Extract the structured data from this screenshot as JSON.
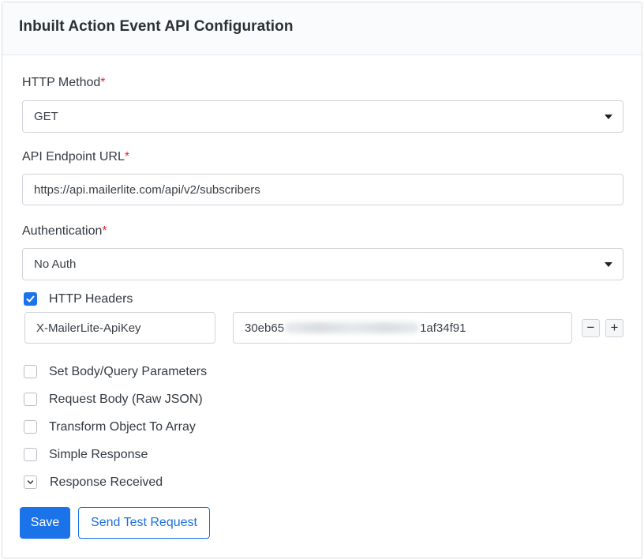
{
  "panel": {
    "title": "Inbuilt Action Event API Configuration"
  },
  "http_method": {
    "label": "HTTP Method",
    "required_mark": "*",
    "value": "GET"
  },
  "endpoint": {
    "label": "API Endpoint URL",
    "required_mark": "*",
    "value": "https://api.mailerlite.com/api/v2/subscribers"
  },
  "authentication": {
    "label": "Authentication",
    "required_mark": "*",
    "value": "No Auth"
  },
  "http_headers": {
    "label": "HTTP Headers",
    "checked": true,
    "header_key": "X-MailerLite-ApiKey",
    "header_value_prefix": "30eb65",
    "header_value_suffix": "1af34f91",
    "remove_label": "−",
    "add_label": "+"
  },
  "options": [
    {
      "label": "Set Body/Query Parameters",
      "checked": false
    },
    {
      "label": "Request Body (Raw JSON)",
      "checked": false
    },
    {
      "label": "Transform Object To Array",
      "checked": false
    },
    {
      "label": "Simple Response",
      "checked": false
    },
    {
      "label": "Response Received",
      "checked": false,
      "style": "chevron"
    }
  ],
  "actions": {
    "save_label": "Save",
    "test_label": "Send Test Request"
  },
  "colors": {
    "accent": "#1a73e8",
    "required": "#d72d2d"
  }
}
